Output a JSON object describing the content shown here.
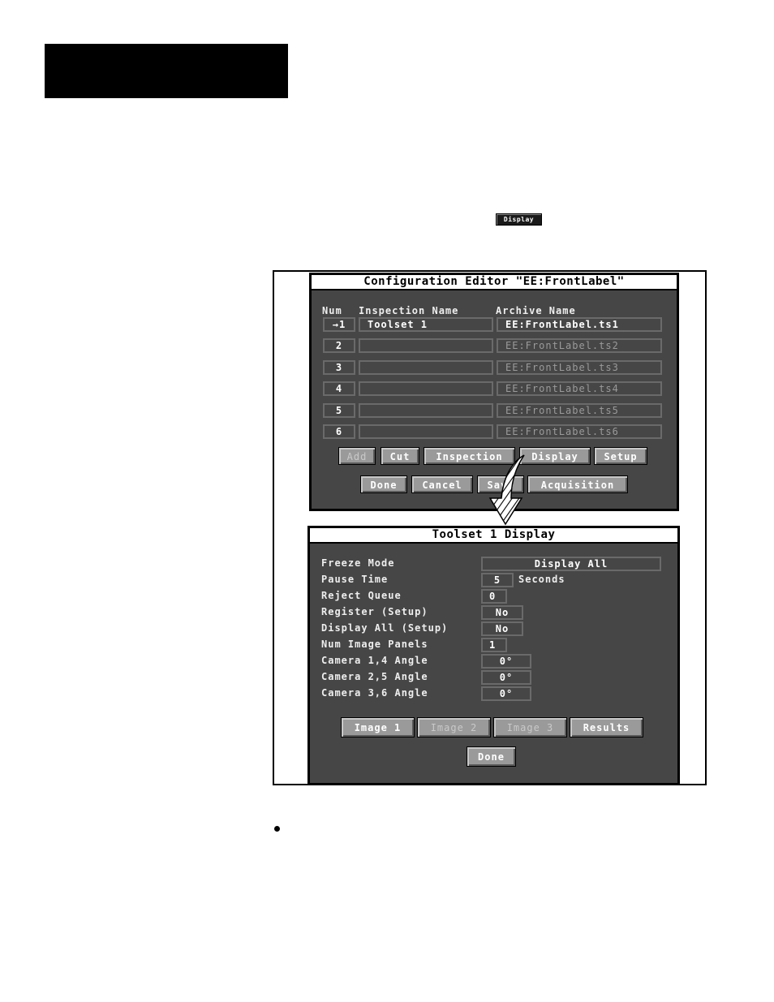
{
  "page": {
    "inline_button_label": "Display",
    "bullet_symbol": "•"
  },
  "config_editor": {
    "title": "Configuration Editor \"EE:FrontLabel\"",
    "columns": [
      "Num",
      "Inspection Name",
      "Archive Name"
    ],
    "rows": [
      {
        "num": "→1",
        "inspection": "Toolset 1",
        "archive": "EE:FrontLabel.ts1",
        "active": true
      },
      {
        "num": "2",
        "inspection": "",
        "archive": "EE:FrontLabel.ts2",
        "active": false
      },
      {
        "num": "3",
        "inspection": "",
        "archive": "EE:FrontLabel.ts3",
        "active": false
      },
      {
        "num": "4",
        "inspection": "",
        "archive": "EE:FrontLabel.ts4",
        "active": false
      },
      {
        "num": "5",
        "inspection": "",
        "archive": "EE:FrontLabel.ts5",
        "active": false
      },
      {
        "num": "6",
        "inspection": "",
        "archive": "EE:FrontLabel.ts6",
        "active": false
      }
    ],
    "buttons_row1": [
      {
        "label": "Add",
        "enabled": false
      },
      {
        "label": "Cut",
        "enabled": true
      },
      {
        "label": "Inspection",
        "enabled": true
      },
      {
        "label": "Display",
        "enabled": true
      },
      {
        "label": "Setup",
        "enabled": true
      }
    ],
    "buttons_row2": [
      {
        "label": "Done",
        "enabled": true
      },
      {
        "label": "Cancel",
        "enabled": true
      },
      {
        "label": "Save",
        "enabled": true
      },
      {
        "label": "Acquisition",
        "enabled": true
      }
    ]
  },
  "display_dialog": {
    "title": "Toolset 1 Display",
    "fields": [
      {
        "label": "Freeze Mode",
        "value": "Display All"
      },
      {
        "label": "Pause Time",
        "value": "5",
        "unit": "Seconds"
      },
      {
        "label": "Reject Queue",
        "value": "0"
      },
      {
        "label": "Register (Setup)",
        "value": "No"
      },
      {
        "label": "Display All (Setup)",
        "value": "No"
      },
      {
        "label": "Num Image Panels",
        "value": "1"
      },
      {
        "label": "Camera 1,4 Angle",
        "value": "0°"
      },
      {
        "label": "Camera 2,5 Angle",
        "value": "0°"
      },
      {
        "label": "Camera 3,6 Angle",
        "value": "0°"
      }
    ],
    "buttons": [
      {
        "label": "Image 1",
        "enabled": true
      },
      {
        "label": "Image 2",
        "enabled": false
      },
      {
        "label": "Image 3",
        "enabled": false
      },
      {
        "label": "Results",
        "enabled": true
      }
    ],
    "done_label": "Done"
  }
}
